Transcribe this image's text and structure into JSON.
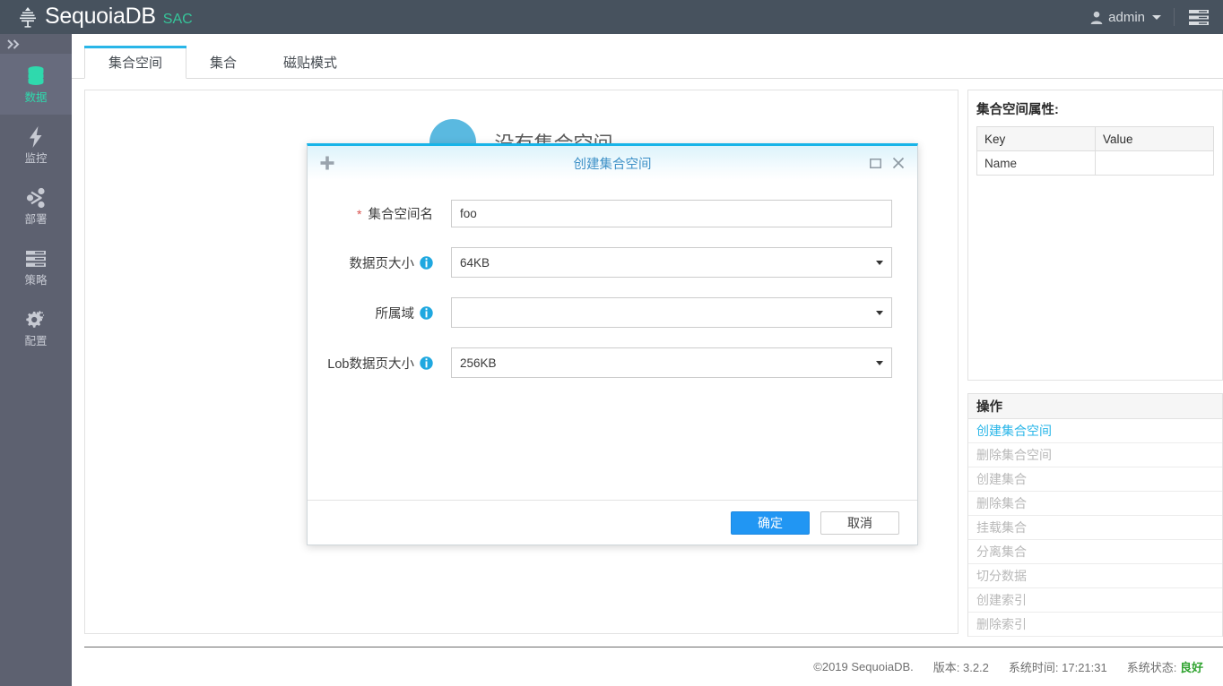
{
  "header": {
    "brand_name": "SequoiaDB",
    "brand_suffix": "SAC",
    "user_label": "admin",
    "user_icon": "user-icon",
    "menu_icon": "list-menu-icon"
  },
  "sidebar": {
    "toggle_icon": "double-chevron-right-icon",
    "items": [
      {
        "label": "数据",
        "icon": "database-icon",
        "active": true
      },
      {
        "label": "监控",
        "icon": "lightning-bolt-icon",
        "active": false
      },
      {
        "label": "部署",
        "icon": "share-nodes-icon",
        "active": false
      },
      {
        "label": "策略",
        "icon": "list-rows-icon",
        "active": false
      },
      {
        "label": "配置",
        "icon": "gears-icon",
        "active": false
      }
    ]
  },
  "tabs": [
    {
      "label": "集合空间",
      "active": true
    },
    {
      "label": "集合",
      "active": false
    },
    {
      "label": "磁贴模式",
      "active": false
    }
  ],
  "main": {
    "empty_state_text": "没有集合空间",
    "empty_state_icon": "info-circle-large-icon"
  },
  "properties_panel": {
    "title": "集合空间属性:",
    "columns": [
      "Key",
      "Value"
    ],
    "rows": [
      {
        "key": "Name",
        "value": ""
      }
    ]
  },
  "operations_panel": {
    "title": "操作",
    "items": [
      {
        "label": "创建集合空间",
        "enabled": true
      },
      {
        "label": "删除集合空间",
        "enabled": false
      },
      {
        "label": "创建集合",
        "enabled": false
      },
      {
        "label": "删除集合",
        "enabled": false
      },
      {
        "label": "挂载集合",
        "enabled": false
      },
      {
        "label": "分离集合",
        "enabled": false
      },
      {
        "label": "切分数据",
        "enabled": false
      },
      {
        "label": "创建索引",
        "enabled": false
      },
      {
        "label": "删除索引",
        "enabled": false
      }
    ]
  },
  "footer": {
    "copyright": "©2019 SequoiaDB.",
    "version_label": "版本: 3.2.2",
    "time_label": "系统时间: 17:21:31",
    "status_label": "系统状态:",
    "status_value": "良好"
  },
  "modal": {
    "title": "创建集合空间",
    "plus_icon": "plus-icon",
    "maximize_icon": "maximize-icon",
    "close_icon": "close-icon",
    "fields": {
      "name": {
        "label": "集合空间名",
        "required": true,
        "value": "foo",
        "placeholder": ""
      },
      "page_size": {
        "label": "数据页大小",
        "info_icon": "info-icon",
        "value": "64KB"
      },
      "domain": {
        "label": "所属域",
        "info_icon": "info-icon",
        "value": ""
      },
      "lob_page_size": {
        "label": "Lob数据页大小",
        "info_icon": "info-icon",
        "value": "256KB"
      }
    },
    "confirm_label": "确定",
    "cancel_label": "取消"
  },
  "colors": {
    "header_bg": "#47525e",
    "sidebar_bg": "#5d6170",
    "accent_cyan": "#29b6e8",
    "accent_green": "#2fd9ad",
    "primary_button": "#2196f3",
    "status_ok": "#2fa32f"
  }
}
